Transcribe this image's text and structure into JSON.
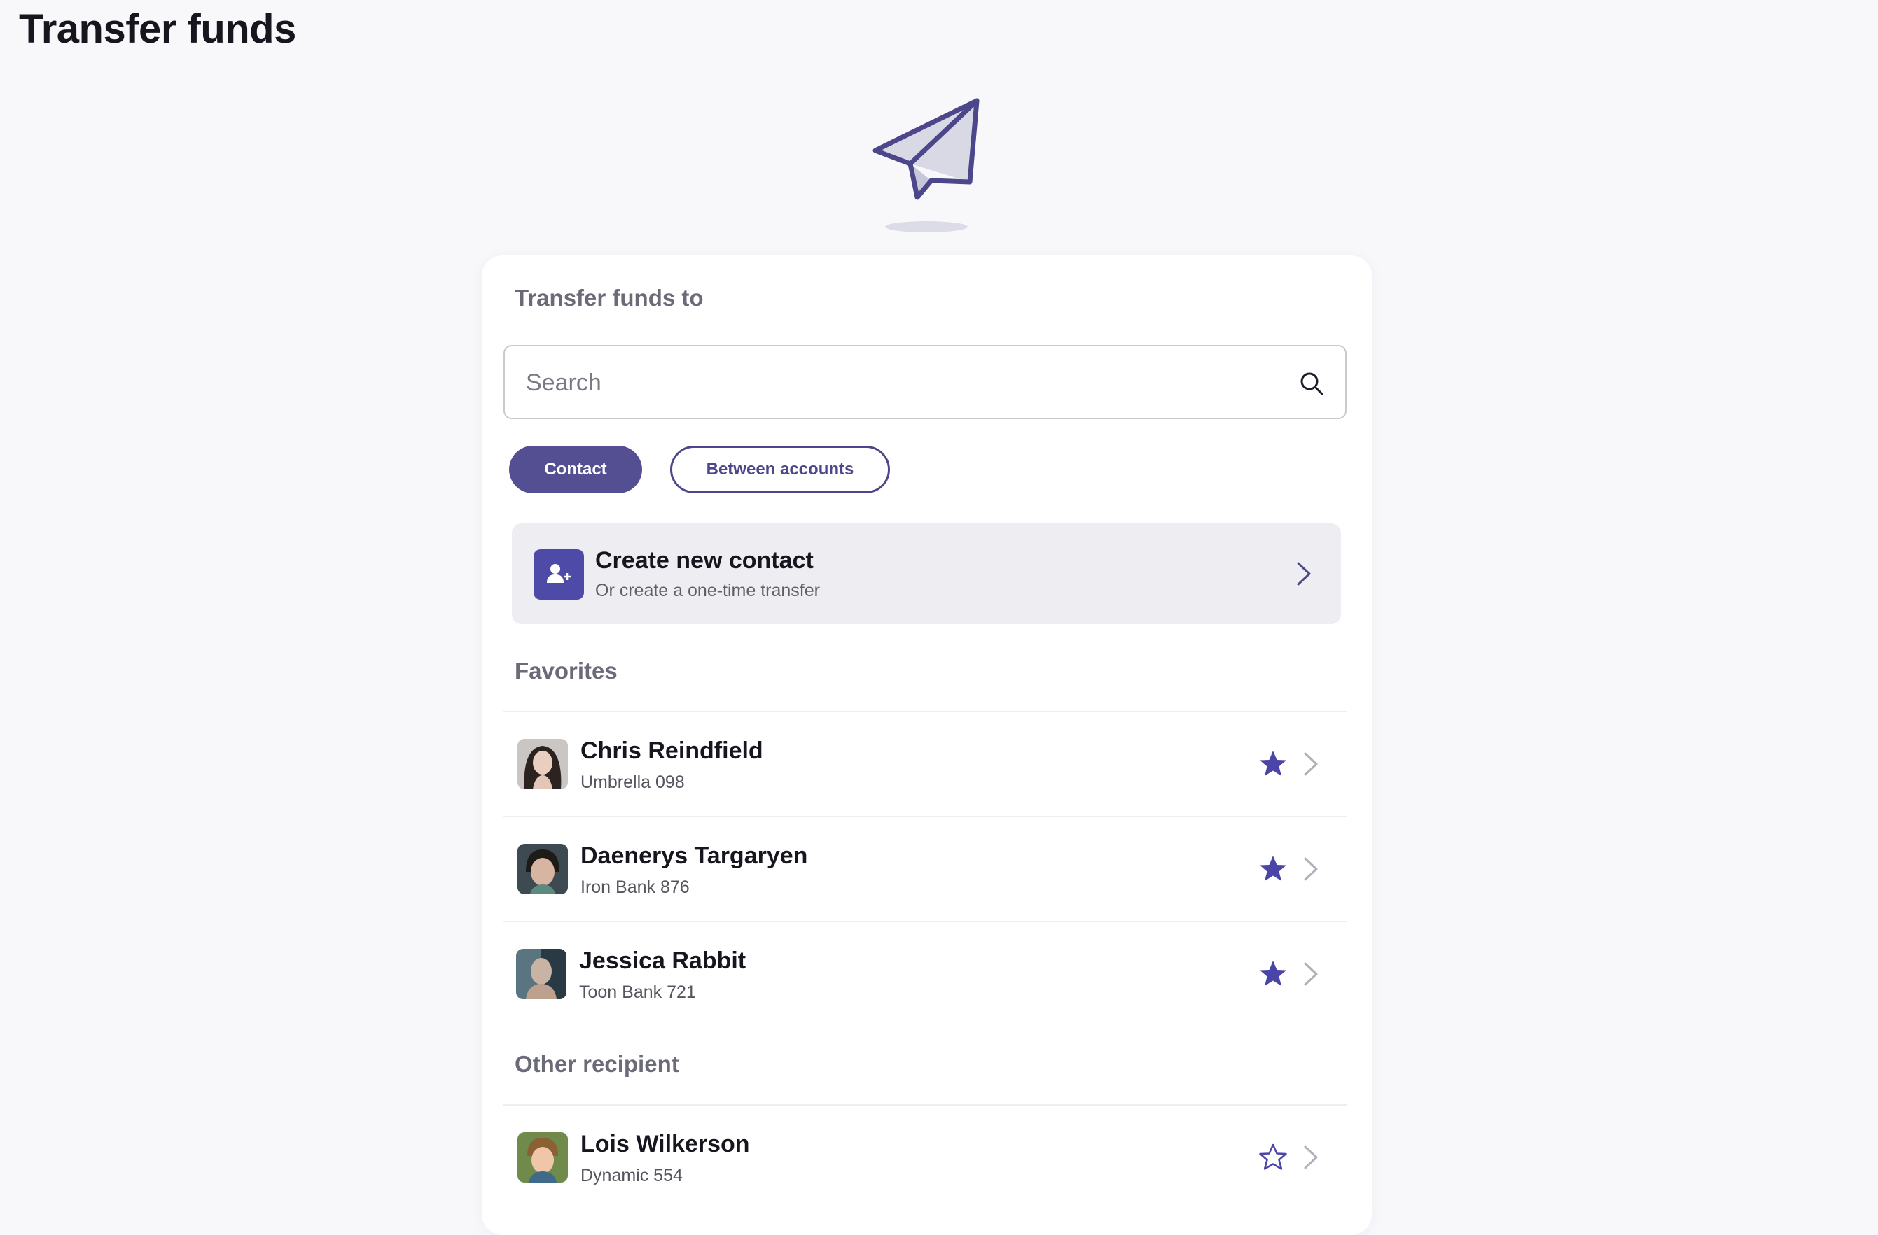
{
  "page": {
    "title": "Transfer funds"
  },
  "hero": {
    "icon": "paper-plane-icon"
  },
  "card": {
    "heading": "Transfer funds to",
    "search": {
      "placeholder": "Search",
      "value": ""
    },
    "tabs": [
      {
        "label": "Contact",
        "active": true
      },
      {
        "label": "Between accounts",
        "active": false
      }
    ],
    "create": {
      "title": "Create new contact",
      "subtitle": "Or create a one-time transfer",
      "icon": "add-user-icon"
    },
    "favorites": {
      "label": "Favorites",
      "items": [
        {
          "name": "Chris Reindfield",
          "bank": "Umbrella 098",
          "favorite": true
        },
        {
          "name": "Daenerys Targaryen",
          "bank": "Iron Bank 876",
          "favorite": true
        },
        {
          "name": "Jessica Rabbit",
          "bank": "Toon Bank 721",
          "favorite": true
        }
      ]
    },
    "others": {
      "label": "Other recipient",
      "items": [
        {
          "name": "Lois Wilkerson",
          "bank": "Dynamic 554",
          "favorite": false
        }
      ]
    }
  },
  "colors": {
    "accent": "#544f92",
    "star": "#4a45a6",
    "create_bg": "#ededf2"
  }
}
